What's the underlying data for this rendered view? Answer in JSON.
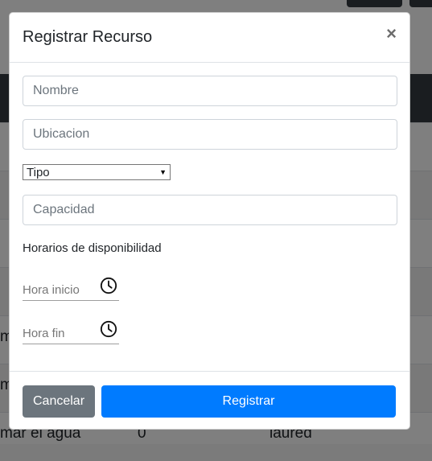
{
  "background": {
    "rows": [
      {
        "col1": "m",
        "col2": "",
        "col3": ""
      },
      {
        "col1": "m",
        "col2": "",
        "col3": ""
      },
      {
        "col1": "mar el agua",
        "col2": "0",
        "col3": "laured"
      }
    ],
    "sort_icon": "↑↓"
  },
  "modal": {
    "title": "Registrar Recurso",
    "close_label": "×",
    "nombre_placeholder": "Nombre",
    "ubicacion_placeholder": "Ubicacion",
    "tipo_selected": "Tipo",
    "tipo_arrow": "▼",
    "capacidad_placeholder": "Capacidad",
    "horarios_label": "Horarios de disponibilidad",
    "hora_inicio_placeholder": "Hora inicio",
    "hora_fin_placeholder": "Hora fin",
    "cancel_label": "Cancelar",
    "submit_label": "Registrar"
  },
  "icons": {
    "close": "close-icon",
    "clock": "clock-icon",
    "dropdown": "chevron-down-icon"
  },
  "colors": {
    "primary": "#007bff",
    "secondary": "#6c757d",
    "table_header": "#343a40"
  }
}
